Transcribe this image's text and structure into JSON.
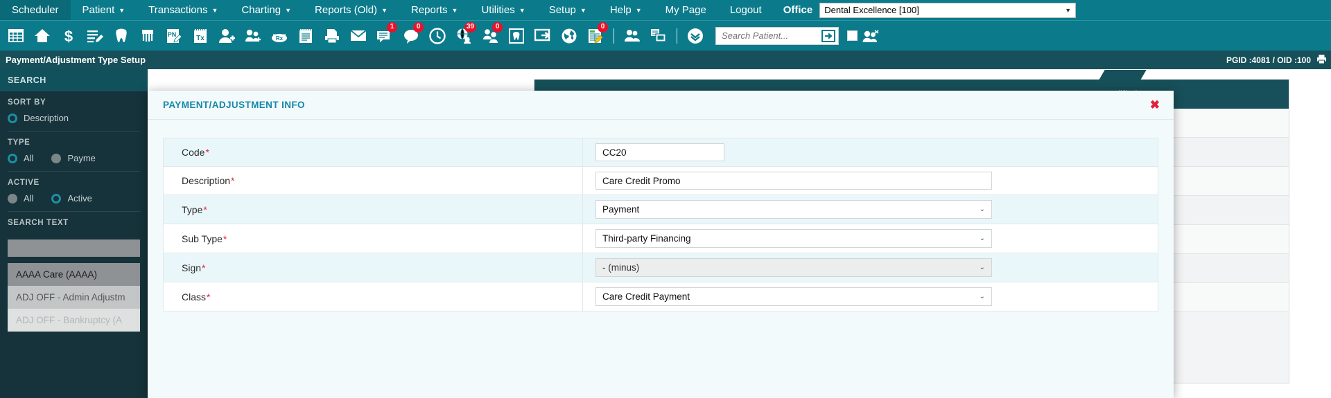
{
  "menubar": {
    "items": [
      {
        "label": "Scheduler",
        "has_caret": false
      },
      {
        "label": "Patient",
        "has_caret": true
      },
      {
        "label": "Transactions",
        "has_caret": true
      },
      {
        "label": "Charting",
        "has_caret": true
      },
      {
        "label": "Reports (Old)",
        "has_caret": true
      },
      {
        "label": "Reports",
        "has_caret": true
      },
      {
        "label": "Utilities",
        "has_caret": true
      },
      {
        "label": "Setup",
        "has_caret": true
      },
      {
        "label": "Help",
        "has_caret": true
      },
      {
        "label": "My Page",
        "has_caret": false
      },
      {
        "label": "Logout",
        "has_caret": false
      }
    ],
    "office_label": "Office",
    "office_value": "Dental Excellence [100]"
  },
  "toolbar": {
    "icons": [
      {
        "name": "calendar-grid-icon",
        "badge": null
      },
      {
        "name": "home-icon",
        "badge": null
      },
      {
        "name": "dollar-sign-icon",
        "badge": null
      },
      {
        "name": "ledger-edit-icon",
        "badge": null
      },
      {
        "name": "tooth-icon",
        "badge": null
      },
      {
        "name": "perio-chart-icon",
        "badge": null
      },
      {
        "name": "progress-note-icon",
        "badge": null
      },
      {
        "name": "treatment-plan-icon",
        "badge": null
      },
      {
        "name": "add-patient-icon",
        "badge": null
      },
      {
        "name": "add-family-icon",
        "badge": null
      },
      {
        "name": "prescription-rx-icon",
        "badge": null
      },
      {
        "name": "notepad-icon",
        "badge": null
      },
      {
        "name": "print-document-icon",
        "badge": null
      },
      {
        "name": "envelope-mail-icon",
        "badge": null
      },
      {
        "name": "messages-icon",
        "badge": "1"
      },
      {
        "name": "chat-bubble-icon",
        "badge": "0"
      },
      {
        "name": "clock-icon",
        "badge": null
      },
      {
        "name": "globe-contacts-icon",
        "badge": "39"
      },
      {
        "name": "patients-group-icon",
        "badge": "0"
      },
      {
        "name": "tooth-frame-icon",
        "badge": null
      },
      {
        "name": "screen-share-icon",
        "badge": null
      },
      {
        "name": "globe-icon",
        "badge": null
      },
      {
        "name": "spreadsheet-edit-icon",
        "badge": "0"
      },
      {
        "name": "people-group-icon",
        "badge": null
      },
      {
        "name": "multi-window-icon",
        "badge": null
      },
      {
        "name": "chevron-circle-down-icon",
        "badge": null
      }
    ],
    "search_placeholder": "Search Patient...",
    "search_value": ""
  },
  "titlebar": {
    "page_title": "Payment/Adjustment Type Setup",
    "pgid_oid": "PGID :4081  /  OID :100"
  },
  "sidebar": {
    "header": "SEARCH",
    "sort_by": {
      "label": "SORT BY",
      "options": [
        {
          "label": "Description",
          "selected": true
        }
      ]
    },
    "type": {
      "label": "TYPE",
      "options": [
        {
          "label": "All",
          "selected": true
        },
        {
          "label": "Payme",
          "selected": false
        }
      ]
    },
    "active": {
      "label": "ACTIVE",
      "options": [
        {
          "label": "All",
          "selected": false
        },
        {
          "label": "Active",
          "selected": true
        }
      ]
    },
    "search_text": {
      "label": "SEARCH TEXT",
      "value": ""
    },
    "list_items": [
      {
        "label": "AAAA Care (AAAA)"
      },
      {
        "label": "ADJ OFF - Admin Adjustm"
      },
      {
        "label": "ADJ OFF - Bankruptcy (A"
      }
    ]
  },
  "background_table": {
    "column_header": "Modified On"
  },
  "modal": {
    "title": "PAYMENT/ADJUSTMENT INFO",
    "close_label": "✖",
    "fields": [
      {
        "label": "Code",
        "required": true,
        "control": "text",
        "size": "short",
        "value": "CC20"
      },
      {
        "label": "Description",
        "required": true,
        "control": "text",
        "size": "wide",
        "value": "Care Credit Promo"
      },
      {
        "label": "Type",
        "required": true,
        "control": "select",
        "value": "Payment",
        "disabled": false
      },
      {
        "label": "Sub Type",
        "required": true,
        "control": "select",
        "value": "Third-party Financing",
        "disabled": false
      },
      {
        "label": "Sign",
        "required": true,
        "control": "select",
        "value": "- (minus)",
        "disabled": true
      },
      {
        "label": "Class",
        "required": true,
        "control": "select",
        "value": "Care Credit Payment",
        "disabled": false
      }
    ]
  },
  "colors": {
    "teal": "#0b7b8c",
    "dark_teal": "#17505a",
    "sidebar": "#16323a",
    "badge_red": "#e8122b",
    "modal_bg": "#f2fafb",
    "row_alt": "#eaf7fa",
    "accent_title": "#1587a8",
    "required_red": "#e0213a"
  }
}
